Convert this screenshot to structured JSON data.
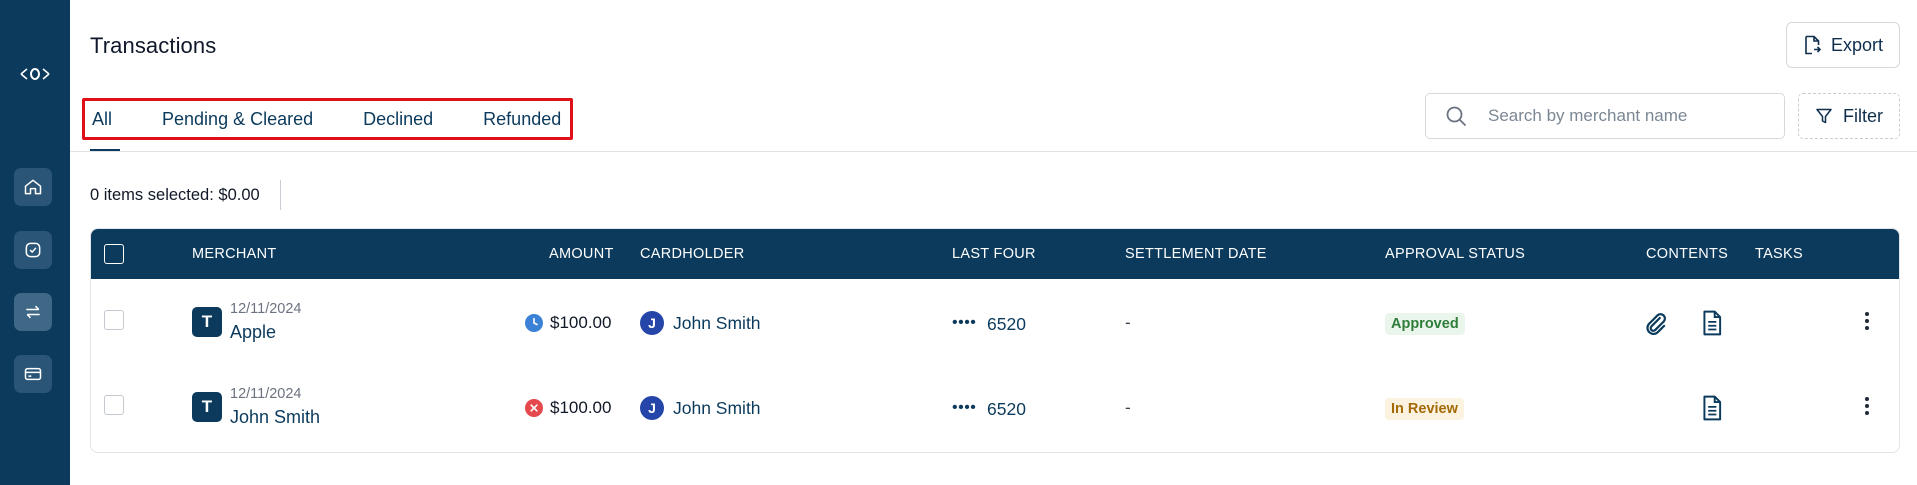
{
  "colors": {
    "sidebar": "#0b3a5c",
    "accent": "#0b3a5c",
    "highlight": "#e0101a",
    "approved": "#2f7d3a",
    "review": "#a46a07"
  },
  "sidebar": {
    "logo_icon": "eye-logo-icon",
    "items": [
      {
        "icon": "home-icon"
      },
      {
        "icon": "check-circle-icon"
      },
      {
        "icon": "transfer-arrows-icon",
        "active": true
      },
      {
        "icon": "credit-card-icon"
      }
    ]
  },
  "header": {
    "title": "Transactions",
    "export_label": "Export"
  },
  "tabs": [
    {
      "label": "All",
      "active": true
    },
    {
      "label": "Pending & Cleared"
    },
    {
      "label": "Declined"
    },
    {
      "label": "Refunded"
    }
  ],
  "search": {
    "placeholder": "Search by merchant name",
    "value": ""
  },
  "filter_label": "Filter",
  "selection_text": "0 items selected: $0.00",
  "table": {
    "columns": [
      "MERCHANT",
      "AMOUNT",
      "CARDHOLDER",
      "LAST FOUR",
      "SETTLEMENT DATE",
      "APPROVAL STATUS",
      "CONTENTS",
      "TASKS"
    ],
    "rows": [
      {
        "avatar": "T",
        "date": "12/11/2024",
        "merchant": "Apple",
        "amount_icon": "clock-icon",
        "amount": "$100.00",
        "cardholder_avatar": "J",
        "cardholder": "John Smith",
        "dots": "••••",
        "last_four": "6520",
        "settlement": "-",
        "status": "Approved",
        "status_kind": "approved",
        "contents": [
          "paperclip-icon",
          "document-icon"
        ]
      },
      {
        "avatar": "T",
        "date": "12/11/2024",
        "merchant": "John Smith",
        "amount_icon": "declined-x-icon",
        "amount": "$100.00",
        "cardholder_avatar": "J",
        "cardholder": "John Smith",
        "dots": "••••",
        "last_four": "6520",
        "settlement": "-",
        "status": "In Review",
        "status_kind": "review",
        "contents": [
          "document-icon"
        ]
      }
    ]
  }
}
